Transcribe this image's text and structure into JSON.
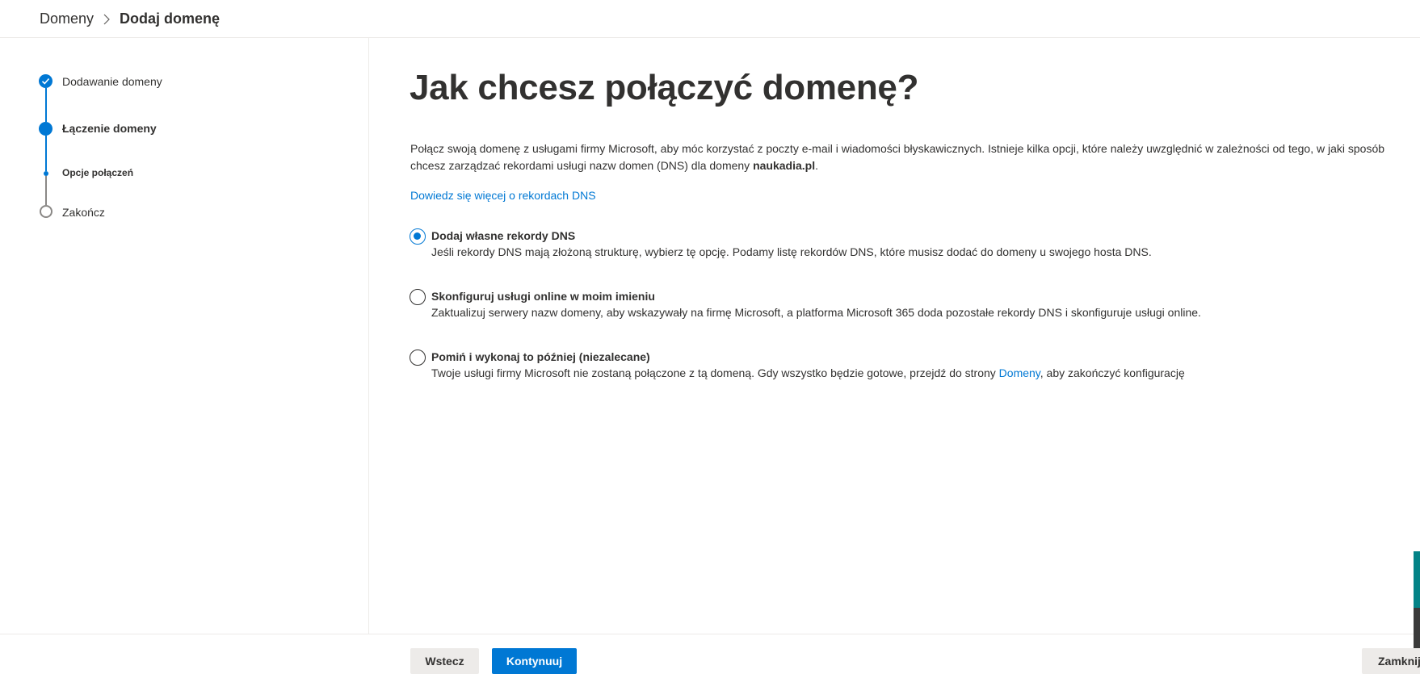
{
  "breadcrumb": {
    "root": "Domeny",
    "current": "Dodaj domenę"
  },
  "wizard": {
    "steps": [
      {
        "label": "Dodawanie domeny",
        "state": "completed"
      },
      {
        "label": "Łączenie domeny",
        "state": "current"
      },
      {
        "label": "Opcje połączeń",
        "state": "current-substep"
      },
      {
        "label": "Zakończ",
        "state": "pending"
      }
    ]
  },
  "main": {
    "title": "Jak chcesz połączyć domenę?",
    "description_part1": "Połącz swoją domenę z usługami firmy Microsoft, aby móc korzystać z poczty e-mail i wiadomości błyskawicznych. Istnieje kilka opcji, które należy uwzględnić w zależności od tego, w jaki sposób chcesz zarządzać rekordami usługi nazw domen (DNS) dla domeny ",
    "domain_name": "naukadia.pl",
    "description_end": ".",
    "learn_more_link": "Dowiedz się więcej o rekordach DNS",
    "options": [
      {
        "title": "Dodaj własne rekordy DNS",
        "description": "Jeśli rekordy DNS mają złożoną strukturę, wybierz tę opcję. Podamy listę rekordów DNS, które musisz dodać do domeny u swojego hosta DNS.",
        "selected": true
      },
      {
        "title": "Skonfiguruj usługi online w moim imieniu",
        "description": "Zaktualizuj serwery nazw domeny, aby wskazywały na firmę Microsoft, a platforma Microsoft 365 doda pozostałe rekordy DNS i skonfiguruje usługi online.",
        "selected": false
      },
      {
        "title": "Pomiń i wykonaj to później (niezalecane)",
        "description_before_link": "Twoje usługi firmy Microsoft nie zostaną połączone z tą domeną. Gdy wszystko będzie gotowe, przejdź do strony ",
        "description_link": "Domeny",
        "description_after_link": ", aby zakończyć konfigurację",
        "selected": false
      }
    ]
  },
  "footer": {
    "back_label": "Wstecz",
    "next_label": "Kontynuuj",
    "close_label": "Zamknij"
  },
  "colors": {
    "accent": "#0078d4",
    "text": "#323130",
    "secondary_button": "#edebe9"
  }
}
